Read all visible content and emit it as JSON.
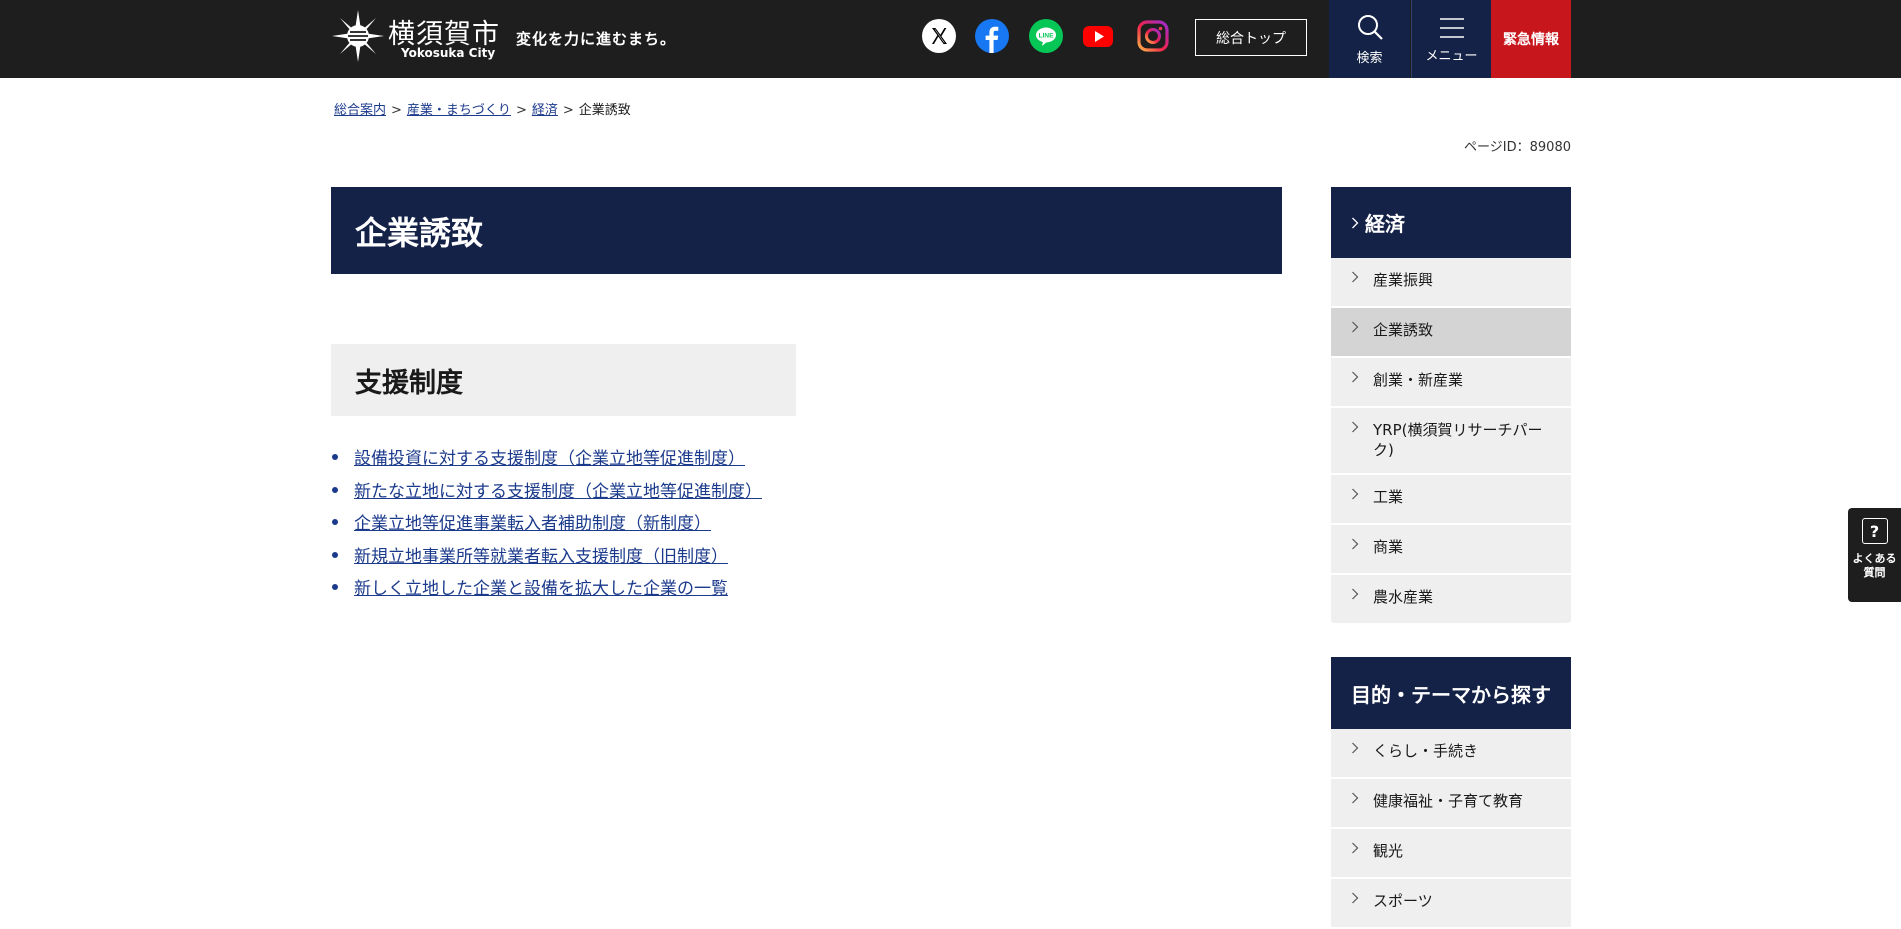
{
  "header": {
    "city_name": "横須賀市",
    "city_en": "Yokosuka City",
    "slogan": "変化を力に進むまち。",
    "top_button": "総合トップ",
    "search_label": "検索",
    "menu_label": "メニュー",
    "emergency_label": "緊急情報",
    "sns": [
      "x-icon",
      "facebook-icon",
      "line-icon",
      "youtube-icon",
      "instagram-icon"
    ],
    "colors": {
      "header_bg": "#1e1e1e",
      "navy": "#152247",
      "emergency": "#c8161d"
    }
  },
  "breadcrumb": {
    "items": [
      "総合案内",
      "産業・まちづくり",
      "経済"
    ],
    "current": "企業誘致",
    "separator": ">"
  },
  "page_id": "ページID：89080",
  "main": {
    "title": "企業誘致",
    "section_heading": "支援制度",
    "links": [
      "設備投資に対する支援制度（企業立地等促進制度）",
      "新たな立地に対する支援制度（企業立地等促進制度）",
      "企業立地等促進事業転入者補助制度（新制度）",
      "新規立地事業所等就業者転入支援制度（旧制度）",
      "新しく立地した企業と設備を拡大した企業の一覧"
    ]
  },
  "sidebar": {
    "category_title": "経済",
    "category_items": [
      "産業振興",
      "企業誘致",
      "創業・新産業",
      "YRP(横須賀リサーチパーク)",
      "工業",
      "商業",
      "農水産業"
    ],
    "active_item": "企業誘致",
    "theme_title": "目的・テーマから探す",
    "theme_items": [
      "くらし・手続き",
      "健康福祉・子育て教育",
      "観光",
      "スポーツ"
    ]
  },
  "faq": {
    "label_line1": "よくある",
    "label_line2": "質問",
    "icon_text": "?"
  }
}
